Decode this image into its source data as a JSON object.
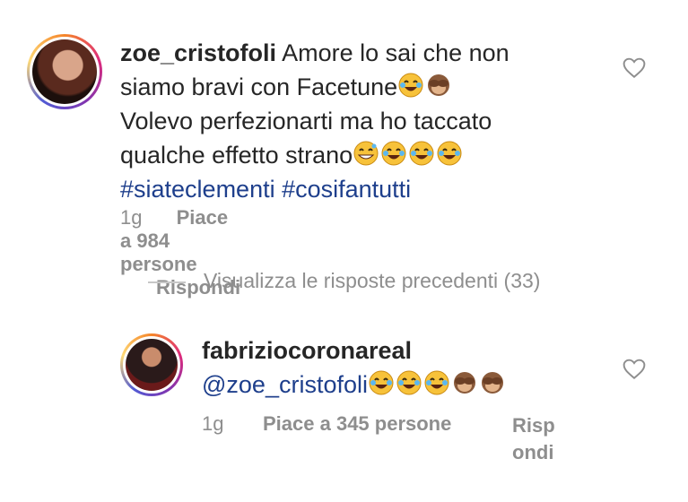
{
  "comments": [
    {
      "username": "zoe_cristofoli",
      "line1": "Amore lo sai che non",
      "line2": "siamo bravi con Facetune",
      "line3": "Volevo perfezionarti ma ho taccato",
      "line4": "qualche effetto strano",
      "hashtags": "#siateclementi #cosifantutti",
      "time": "1g",
      "likes": "Piace a 984 persone",
      "reply": "Rispondi",
      "heart_icon": "heart-outline-icon"
    },
    {
      "username": "fabriziocoronareal",
      "mention": "@zoe_cristofoli",
      "time": "1g",
      "likes": "Piace a 345 persone",
      "reply_part1": "Risp",
      "reply_part2": "ondi",
      "heart_icon": "heart-outline-icon"
    }
  ],
  "view_previous_replies": "Visualizza le risposte precedenti (33)",
  "colors": {
    "text": "#262626",
    "muted": "#8e8e8e",
    "link": "#1e3f8c"
  }
}
